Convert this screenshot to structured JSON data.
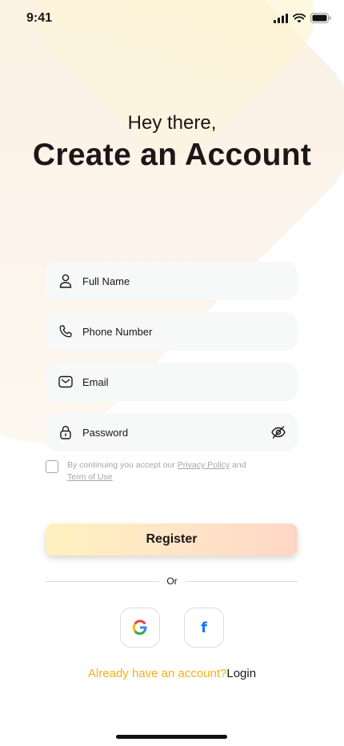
{
  "status_bar": {
    "time": "9:41"
  },
  "header": {
    "greeting": "Hey there,",
    "title": "Create an Account"
  },
  "form": {
    "full_name": {
      "placeholder": "Full Name",
      "icon": "user-icon"
    },
    "phone": {
      "placeholder": "Phone Number",
      "icon": "phone-icon"
    },
    "email": {
      "placeholder": "Email",
      "icon": "mail-icon"
    },
    "password": {
      "placeholder": "Password",
      "icon": "lock-icon",
      "toggle_icon": "eye-off-icon"
    }
  },
  "terms": {
    "prefix": "By continuing you accept our ",
    "privacy_link": "Privacy Policy",
    "middle": " and",
    "terms_link": "Term of Use",
    "checked": false
  },
  "register_label": "Register",
  "divider_label": "Or",
  "social": {
    "google_icon": "google-icon",
    "facebook_icon": "facebook-icon",
    "facebook_letter": "f"
  },
  "footer": {
    "prompt": "Already have an account?",
    "login_label": "Login"
  },
  "colors": {
    "text": "#1d1617",
    "muted": "#ada4a5",
    "field_bg": "#f7f8f8",
    "accent": "#f5b018",
    "facebook": "#1877f2"
  }
}
